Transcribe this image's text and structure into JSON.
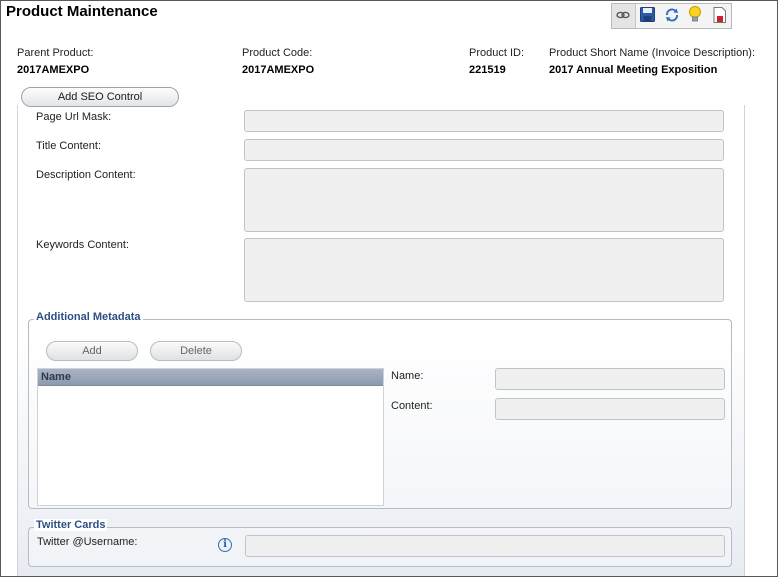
{
  "window": {
    "title": "Product Maintenance"
  },
  "toolbar": {
    "buttons": [
      {
        "icon": "link-icon"
      },
      {
        "icon": "save-icon"
      },
      {
        "icon": "refresh-icon"
      },
      {
        "icon": "lightbulb-icon"
      },
      {
        "icon": "report-icon"
      }
    ]
  },
  "product": {
    "parent_label": "Parent Product:",
    "parent_value": "2017AMEXPO",
    "code_label": "Product Code:",
    "code_value": "2017AMEXPO",
    "id_label": "Product ID:",
    "id_value": "221519",
    "short_name_label": "Product Short Name (Invoice Description):",
    "short_name_value": "2017 Annual Meeting Exposition"
  },
  "tab": {
    "label": "Add SEO Control"
  },
  "seo": {
    "page_url_mask_label": "Page Url Mask:",
    "page_url_mask_value": "",
    "title_content_label": "Title Content:",
    "title_content_value": "",
    "description_content_label": "Description Content:",
    "description_content_value": "",
    "keywords_content_label": "Keywords Content:",
    "keywords_content_value": ""
  },
  "metadata": {
    "group_title": "Additional Metadata",
    "add_label": "Add",
    "delete_label": "Delete",
    "grid_header": "Name",
    "name_label": "Name:",
    "name_value": "",
    "content_label": "Content:",
    "content_value": ""
  },
  "twitter": {
    "group_title": "Twitter Cards",
    "username_label": "Twitter @Username:",
    "username_value": "",
    "info_icon": "info-icon"
  }
}
